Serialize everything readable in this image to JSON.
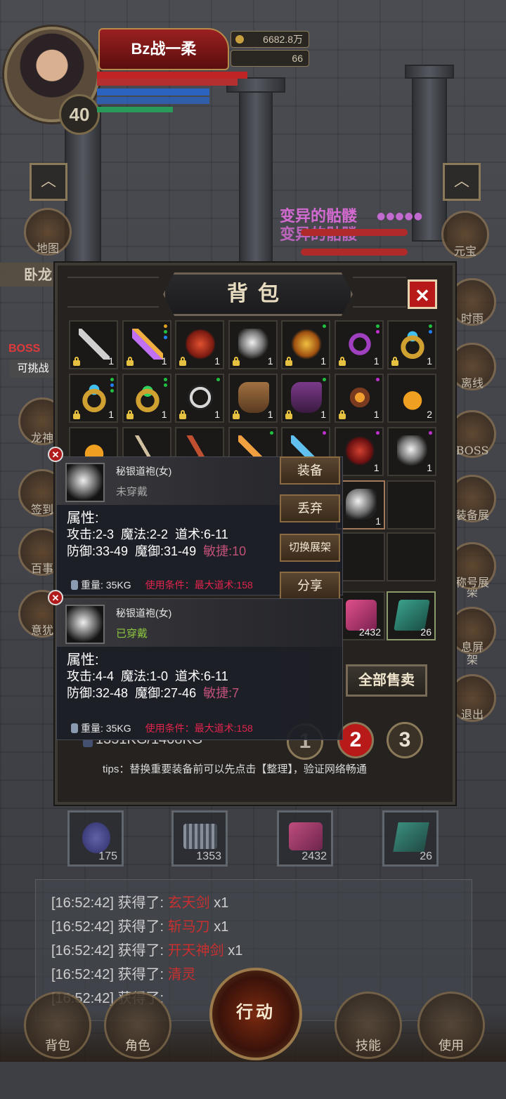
{
  "player": {
    "name": "Bz战一柔",
    "level": "40",
    "gold": "6682.8万",
    "gems": "66"
  },
  "world": {
    "mob_name": "变异的骷髅",
    "left_side_label": "卧龙",
    "boss_label": "BOSS",
    "boss_sub": "可挑战"
  },
  "left_menu": [
    {
      "label": "地图"
    },
    {
      "label": "龙神"
    },
    {
      "label": "签到"
    },
    {
      "label": "百事"
    },
    {
      "label": "意犹"
    }
  ],
  "right_menu": [
    {
      "label": "元宝"
    },
    {
      "label": "时雨"
    },
    {
      "label": "离线"
    },
    {
      "label": "BOSS"
    },
    {
      "label": "装备展架"
    },
    {
      "label": "称号展架"
    },
    {
      "label": "息屏"
    },
    {
      "label": "退出"
    }
  ],
  "bag": {
    "title": "背包",
    "close_label": "✕",
    "sell_all_label": "全部售卖",
    "weight_text": "1351KG/1408KG",
    "pages": [
      "1",
      "2",
      "3"
    ],
    "tips_text": "tips：替换重要装备前可以先点击【整理】，验证网络畅通",
    "row1": [
      {
        "icon": "pickaxe-icon",
        "count": "1",
        "locked": true,
        "dots": []
      },
      {
        "icon": "sword-icon",
        "count": "1",
        "locked": true,
        "dots": [
          "#e0a020",
          "#20c040",
          "#2080ff"
        ]
      },
      {
        "icon": "armor-icon",
        "count": "1",
        "locked": true,
        "dots": []
      },
      {
        "icon": "robe-icon",
        "count": "1",
        "locked": true,
        "dots": []
      },
      {
        "icon": "helmet-icon",
        "count": "1",
        "locked": true,
        "dots": [
          "#20c040"
        ]
      },
      {
        "icon": "necklace-icon",
        "count": "1",
        "locked": true,
        "dots": [
          "#20c040",
          "#c030d0"
        ]
      },
      {
        "icon": "ring-icon",
        "count": "1",
        "locked": true,
        "dots": [
          "#20c040",
          "#2080ff"
        ]
      }
    ],
    "row2": [
      {
        "icon": "ring-icon",
        "count": "1",
        "locked": true,
        "dots": [
          "#20c040",
          "#2080ff",
          "#20c040"
        ]
      },
      {
        "icon": "ring-green-icon",
        "count": "1",
        "locked": true,
        "dots": [
          "#20c040",
          "#20c040"
        ]
      },
      {
        "icon": "belt-icon",
        "count": "1",
        "locked": true,
        "dots": [
          "#20c040"
        ]
      },
      {
        "icon": "boots-icon",
        "count": "1",
        "locked": true,
        "dots": []
      },
      {
        "icon": "boots-purple-icon",
        "count": "1",
        "locked": true,
        "dots": [
          "#20c040"
        ]
      },
      {
        "icon": "amulet-icon",
        "count": "1",
        "locked": true,
        "dots": [
          "#c030d0"
        ]
      },
      {
        "icon": "potion-icon",
        "count": "2",
        "locked": false,
        "dots": []
      }
    ],
    "row3": [
      {
        "icon": "potion-icon",
        "count": "",
        "locked": false,
        "dots": []
      },
      {
        "icon": "bow-icon",
        "count": "",
        "locked": false,
        "dots": []
      },
      {
        "icon": "blade-icon",
        "count": "",
        "locked": false,
        "dots": []
      },
      {
        "icon": "spear-icon",
        "count": "",
        "locked": false,
        "dots": [
          "#20c040"
        ]
      },
      {
        "icon": "sword-blue-icon",
        "count": "",
        "locked": false,
        "dots": [
          "#c030d0"
        ]
      },
      {
        "icon": "armor-red-icon",
        "count": "1",
        "locked": false,
        "dots": [
          "#c030d0"
        ]
      },
      {
        "icon": "robe-icon",
        "count": "1",
        "locked": false,
        "dots": [
          "#c030d0"
        ]
      }
    ],
    "slot_robe_count": "1",
    "quick_counts": [
      "2432",
      "26"
    ]
  },
  "tooltip_new": {
    "name": "秘银道袍(女)",
    "state": "未穿戴",
    "attr_title": "属性:",
    "line1": "攻击:2-3  魔法:2-2  道术:6-11",
    "line2a": "防御:33-49  魔御:31-49",
    "agility": "敏捷:10",
    "weight": "重量:  35KG",
    "condition": "使用条件：最大道术:158"
  },
  "tooltip_worn": {
    "name": "秘银道袍(女)",
    "state": "已穿戴",
    "attr_title": "属性:",
    "line1": "攻击:4-4  魔法:1-0  道术:6-11",
    "line2a": "防御:32-48  魔御:27-46",
    "agility": "敏捷:7",
    "weight": "重量:  35KG",
    "condition": "使用条件：最大道术:158"
  },
  "tooltip_buttons": {
    "equip": "装备",
    "drop": "丢弃",
    "switch": "切换展架",
    "share": "分享"
  },
  "quick_slots": [
    {
      "count": "175"
    },
    {
      "count": "1353"
    },
    {
      "count": "2432"
    },
    {
      "count": "26"
    }
  ],
  "log": [
    {
      "time": "[16:52:42]",
      "text": "获得了:",
      "item": "玄天剑",
      "qty": "x1"
    },
    {
      "time": "[16:52:42]",
      "text": "获得了:",
      "item": "斩马刀",
      "qty": "x1"
    },
    {
      "time": "[16:52:42]",
      "text": "获得了:",
      "item": "开天神剑",
      "qty": "x1"
    },
    {
      "time": "[16:52:42]",
      "text": "获得了:",
      "item": "清灵",
      "qty": ""
    },
    {
      "time": "[16:52:42]",
      "text": "获得了:",
      "item": "",
      "qty": ""
    }
  ],
  "bottom_nav": {
    "bag": "背包",
    "role": "角色",
    "action": "行动",
    "skill": "技能",
    "use": "使用"
  },
  "colors": {
    "accent_red": "#b81a1a",
    "condition_red": "#e0244c",
    "agility_pink": "#c0507a",
    "worn_green": "#8cc63f",
    "item_red": "#c83030"
  }
}
